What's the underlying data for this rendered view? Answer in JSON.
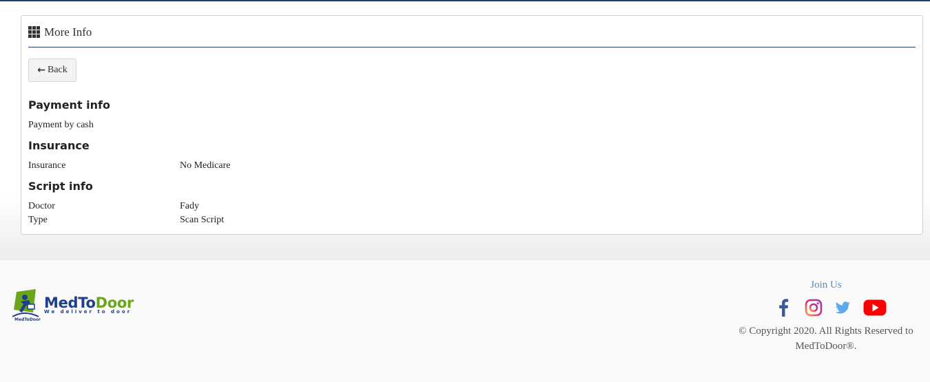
{
  "header": {
    "title": "More Info",
    "icon": "th-grid-icon"
  },
  "back_button": {
    "label": "Back",
    "icon": "arrow-left-icon"
  },
  "payment": {
    "heading": "Payment info",
    "text": "Payment by cash"
  },
  "insurance": {
    "heading": "Insurance",
    "label": "Insurance",
    "value": "No Medicare"
  },
  "script": {
    "heading": "Script info",
    "rows": [
      {
        "label": "Doctor",
        "value": "Fady"
      },
      {
        "label": "Type",
        "value": "Scan Script"
      }
    ]
  },
  "footer": {
    "brand_main": "MedTo",
    "brand_accent": "Door",
    "tagline": "We deliver to door",
    "join_us": "Join Us",
    "copyright_line1": "© Copyright 2020. All Rights Reserved to",
    "copyright_line2": "MedToDoor®.",
    "social": [
      "facebook-icon",
      "instagram-icon",
      "twitter-icon",
      "youtube-icon"
    ]
  },
  "colors": {
    "accent": "#1f3f73",
    "brand_blue": "#1f3f8a",
    "brand_green": "#6aa51c",
    "link": "#4d8dcb"
  }
}
